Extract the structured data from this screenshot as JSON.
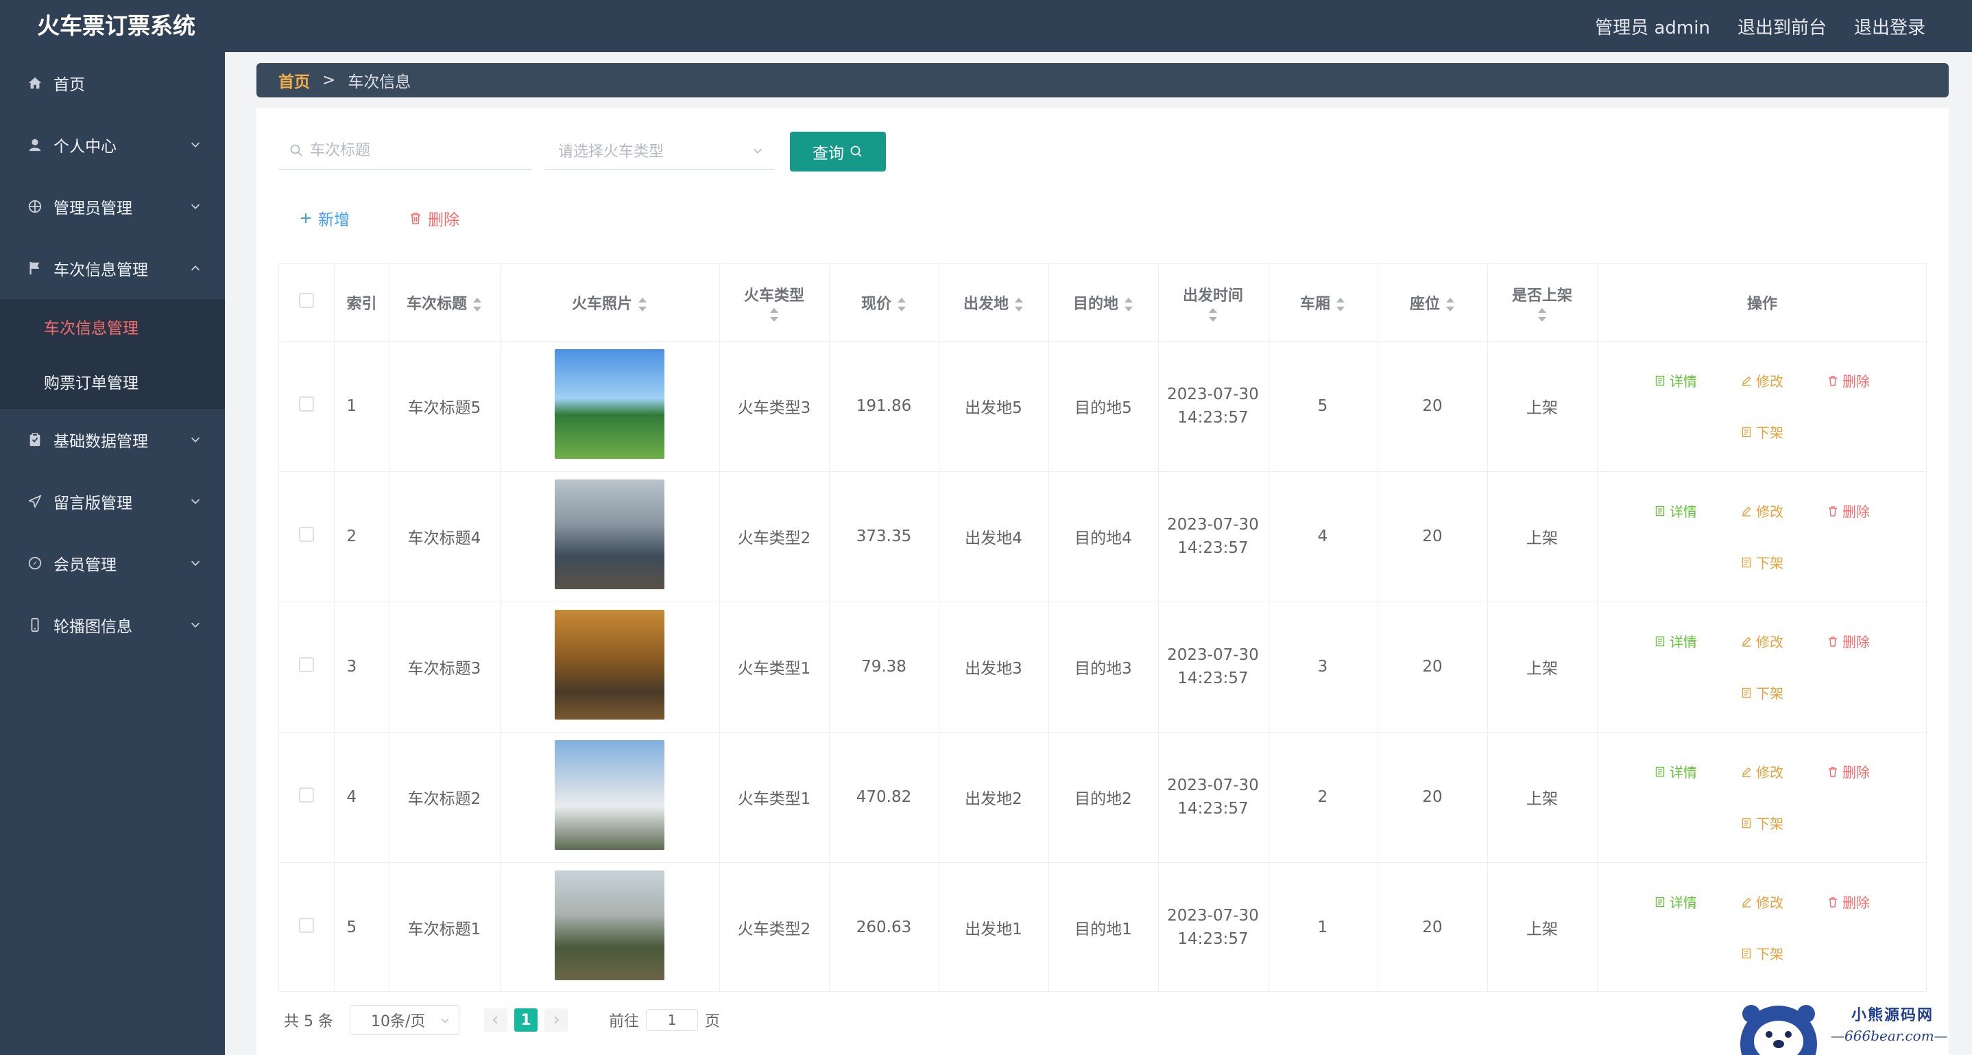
{
  "app": {
    "title": "火车票订票系统"
  },
  "top_links": {
    "admin": "管理员 admin",
    "front": "退出到前台",
    "logout": "退出登录"
  },
  "sidebar": {
    "items": [
      {
        "label": "首页"
      },
      {
        "label": "个人中心"
      },
      {
        "label": "管理员管理"
      },
      {
        "label": "车次信息管理"
      },
      {
        "label": "基础数据管理"
      },
      {
        "label": "留言版管理"
      },
      {
        "label": "会员管理"
      },
      {
        "label": "轮播图信息"
      }
    ],
    "sub_items": [
      {
        "label": "车次信息管理"
      },
      {
        "label": "购票订单管理"
      }
    ]
  },
  "breadcrumb": {
    "home": "首页",
    "sep": ">",
    "current": "车次信息"
  },
  "search": {
    "placeholder": "车次标题",
    "select_placeholder": "请选择火车类型",
    "query_label": "查询"
  },
  "actions": {
    "add": "新增",
    "delete": "删除"
  },
  "table": {
    "headers": {
      "index": "索引",
      "title": "车次标题",
      "photo": "火车照片",
      "type": "火车类型",
      "price": "现价",
      "from": "出发地",
      "to": "目的地",
      "time": "出发时间",
      "car": "车厢",
      "seat": "座位",
      "listed": "是否上架",
      "ops": "操作"
    },
    "ops": {
      "detail": "详情",
      "edit": "修改",
      "remove": "删除",
      "down": "下架"
    },
    "rows": [
      {
        "index": "1",
        "title": "车次标题5",
        "type": "火车类型3",
        "price": "191.86",
        "from": "出发地5",
        "to": "目的地5",
        "date": "2023-07-30",
        "time": "14:23:57",
        "car": "5",
        "seat": "20",
        "listed": "上架"
      },
      {
        "index": "2",
        "title": "车次标题4",
        "type": "火车类型2",
        "price": "373.35",
        "from": "出发地4",
        "to": "目的地4",
        "date": "2023-07-30",
        "time": "14:23:57",
        "car": "4",
        "seat": "20",
        "listed": "上架"
      },
      {
        "index": "3",
        "title": "车次标题3",
        "type": "火车类型1",
        "price": "79.38",
        "from": "出发地3",
        "to": "目的地3",
        "date": "2023-07-30",
        "time": "14:23:57",
        "car": "3",
        "seat": "20",
        "listed": "上架"
      },
      {
        "index": "4",
        "title": "车次标题2",
        "type": "火车类型1",
        "price": "470.82",
        "from": "出发地2",
        "to": "目的地2",
        "date": "2023-07-30",
        "time": "14:23:57",
        "car": "2",
        "seat": "20",
        "listed": "上架"
      },
      {
        "index": "5",
        "title": "车次标题1",
        "type": "火车类型2",
        "price": "260.63",
        "from": "出发地1",
        "to": "目的地1",
        "date": "2023-07-30",
        "time": "14:23:57",
        "car": "1",
        "seat": "20",
        "listed": "上架"
      }
    ]
  },
  "pagination": {
    "total": "共 5 条",
    "page_size": "10条/页",
    "current_page": "1",
    "goto_prefix": "前往",
    "goto_value": "1",
    "goto_suffix": "页"
  },
  "watermark": {
    "line1": "小熊源码网",
    "line2": "—666bear.com—"
  },
  "colors": {
    "sidebar_bg": "#304156",
    "accent": "#159a8a",
    "active_menu": "#f56c6c",
    "page_active": "#16b9a0"
  }
}
